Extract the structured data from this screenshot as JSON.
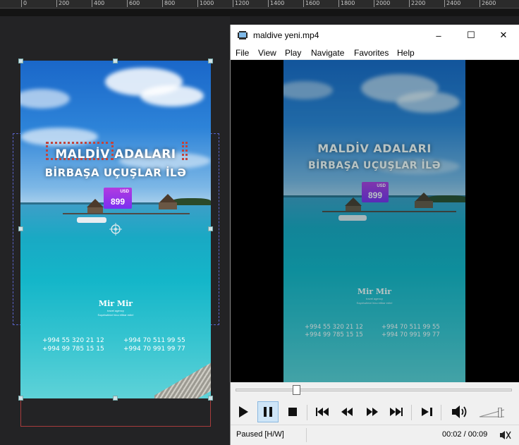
{
  "ruler": {
    "marks": [
      "0",
      "200",
      "400",
      "600",
      "800",
      "1000",
      "1200",
      "1400",
      "1600",
      "1800",
      "2000",
      "2200",
      "2400",
      "2600"
    ]
  },
  "video_text": {
    "headline1": "MALDİV ADALARI",
    "headline2": "BİRBAŞA UÇUŞLAR İLƏ",
    "price_currency": "USD",
    "price_value": "899",
    "logo": "Mir Mir",
    "logo_sub": "travel agency",
    "logo_tagline": "Səyahətinizi bizə etibar edin!",
    "phones_left": [
      "+994 55 320 21 12",
      "+994 99 785 15 15"
    ],
    "phones_right": [
      "+994 70 511 99 55",
      "+994 70 991 99 77"
    ]
  },
  "window": {
    "title": "maldive yeni.mp4",
    "controls": {
      "minimize": "–",
      "maximize": "☐",
      "close": "✕"
    },
    "menu": [
      "File",
      "View",
      "Play",
      "Navigate",
      "Favorites",
      "Help"
    ]
  },
  "player": {
    "progress": 0.22,
    "state": "Paused [H/W]",
    "time": "00:02 / 00:09"
  },
  "colors": {
    "badge": "#9b36e8",
    "selection": "#5a63c9",
    "window_bg": "#f0f0f0"
  }
}
